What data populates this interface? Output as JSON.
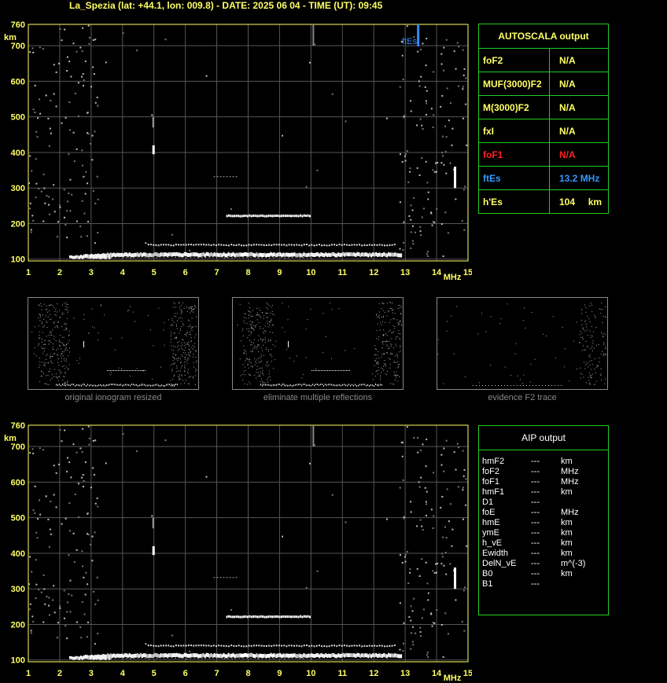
{
  "header": {
    "title": "La_Spezia (lat: +44.1, lon: 009.8) - DATE: 2025 06 04 - TIME (UT): 09:45"
  },
  "chart_data": [
    {
      "type": "scatter",
      "name": "ionogram-top",
      "xlabel": "MHz",
      "ylabel": "km",
      "xlim": [
        1,
        15
      ],
      "ylim": [
        95,
        760
      ],
      "x_ticks": [
        "1",
        "2",
        "3",
        "4",
        "5",
        "6",
        "7",
        "8",
        "9",
        "10",
        "11",
        "12",
        "13",
        "14",
        "15"
      ],
      "y_ticks": [
        "100",
        "200",
        "300",
        "400",
        "500",
        "600",
        "700",
        "760"
      ],
      "grid": true,
      "annotation": {
        "text": "ftEs",
        "x": 13.2,
        "color": "#3388ff"
      }
    },
    {
      "type": "scatter",
      "name": "ionogram-bottom",
      "xlabel": "MHz",
      "ylabel": "km",
      "xlim": [
        1,
        15
      ],
      "ylim": [
        95,
        760
      ],
      "x_ticks": [
        "1",
        "2",
        "3",
        "4",
        "5",
        "6",
        "7",
        "8",
        "9",
        "10",
        "11",
        "12",
        "13",
        "14",
        "15"
      ],
      "y_ticks": [
        "100",
        "200",
        "300",
        "400",
        "500",
        "600",
        "700",
        "760"
      ],
      "grid": true
    }
  ],
  "traces": {
    "es_main": {
      "f": [
        2.3,
        12.9
      ],
      "h": 118
    },
    "es_lower": {
      "f": [
        3.5,
        10.0
      ],
      "h": 106
    },
    "band_140": {
      "f": [
        4.8,
        12.7
      ],
      "h": 142
    },
    "multi_225": {
      "f": [
        7.3,
        10.0
      ],
      "h": 225
    },
    "short_333": {
      "f": [
        6.9,
        7.6
      ],
      "h": 333
    },
    "vert_5": {
      "f": 4.95,
      "h": [
        395,
        420
      ]
    },
    "vert_10": {
      "f": 10.05,
      "h": [
        700,
        760
      ]
    },
    "vert_14": {
      "f": 14.55,
      "h": [
        300,
        360
      ]
    }
  },
  "autoscala": {
    "title": "AUTOSCALA output",
    "rows": [
      {
        "label": "foF2",
        "value": "N/A",
        "color": "#ffff66"
      },
      {
        "label": "MUF(3000)F2",
        "value": "N/A",
        "color": "#ffff66"
      },
      {
        "label": "M(3000)F2",
        "value": "N/A",
        "color": "#ffff66"
      },
      {
        "label": "fxI",
        "value": "N/A",
        "color": "#ffff66"
      },
      {
        "label": "foF1",
        "value": "N/A",
        "color": "#ff2222"
      },
      {
        "label": "ftEs",
        "value": "13.2 MHz",
        "color": "#3399ff"
      },
      {
        "label": "h'Es",
        "value": "104     km",
        "color": "#ffff66"
      }
    ]
  },
  "thumbnails": [
    {
      "caption": "original ionogram resized"
    },
    {
      "caption": "eliminate multiple reflections"
    },
    {
      "caption": "evidence F2 trace"
    }
  ],
  "aip": {
    "title": "AIP output",
    "rows": [
      {
        "param": "hmF2",
        "value": "---",
        "unit": "km"
      },
      {
        "param": "foF2",
        "value": "---",
        "unit": "MHz"
      },
      {
        "param": "foF1",
        "value": "---",
        "unit": "MHz"
      },
      {
        "param": "hmF1",
        "value": "---",
        "unit": "km"
      },
      {
        "param": "D1",
        "value": "---",
        "unit": ""
      },
      {
        "param": "foE",
        "value": "---",
        "unit": "MHz"
      },
      {
        "param": "hmE",
        "value": "---",
        "unit": "km"
      },
      {
        "param": "ymE",
        "value": "---",
        "unit": "km"
      },
      {
        "param": "h_vE",
        "value": "---",
        "unit": "km"
      },
      {
        "param": "Ewidth",
        "value": "---",
        "unit": "km"
      },
      {
        "param": "DelN_vE",
        "value": "---",
        "unit": "m^(-3)"
      },
      {
        "param": "B0",
        "value": "---",
        "unit": "km"
      },
      {
        "param": "B1",
        "value": "---",
        "unit": ""
      }
    ]
  }
}
